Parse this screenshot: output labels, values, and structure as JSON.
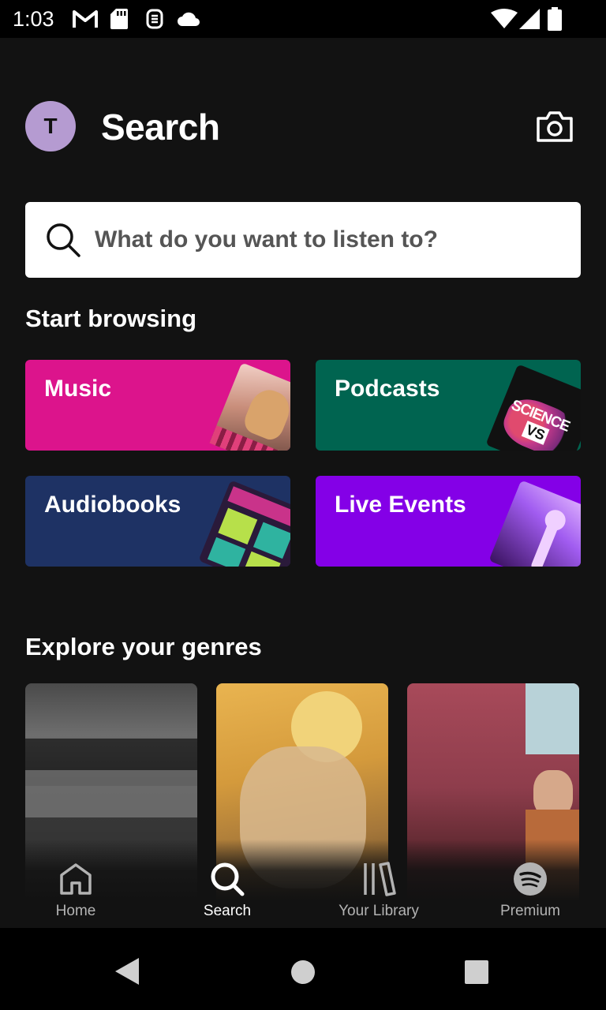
{
  "status_bar": {
    "time": "1:03",
    "left_icons": [
      "gmail-icon",
      "sd-card-icon",
      "sync-icon",
      "cloud-icon"
    ],
    "right_icons": [
      "wifi-icon",
      "cellular-icon",
      "battery-icon"
    ]
  },
  "header": {
    "avatar_letter": "T",
    "title": "Search",
    "camera_icon": "camera-icon"
  },
  "search": {
    "placeholder": "What do you want to listen to?"
  },
  "browse": {
    "title": "Start browsing",
    "tiles": [
      {
        "label": "Music",
        "color": "#dc148c"
      },
      {
        "label": "Podcasts",
        "color": "#006450"
      },
      {
        "label": "Audiobooks",
        "color": "#1e3264"
      },
      {
        "label": "Live Events",
        "color": "#8400e7"
      }
    ]
  },
  "genres": {
    "title": "Explore your genres"
  },
  "bottom_nav": {
    "items": [
      {
        "label": "Home",
        "icon": "home-icon"
      },
      {
        "label": "Search",
        "icon": "search-icon",
        "active": true
      },
      {
        "label": "Your Library",
        "icon": "library-icon"
      },
      {
        "label": "Premium",
        "icon": "spotify-icon"
      }
    ]
  },
  "system_nav": [
    "back-icon",
    "home-circle-icon",
    "recents-icon"
  ],
  "colors": {
    "background": "#121212",
    "text_primary": "#ffffff",
    "text_secondary": "#b3b3b3"
  }
}
